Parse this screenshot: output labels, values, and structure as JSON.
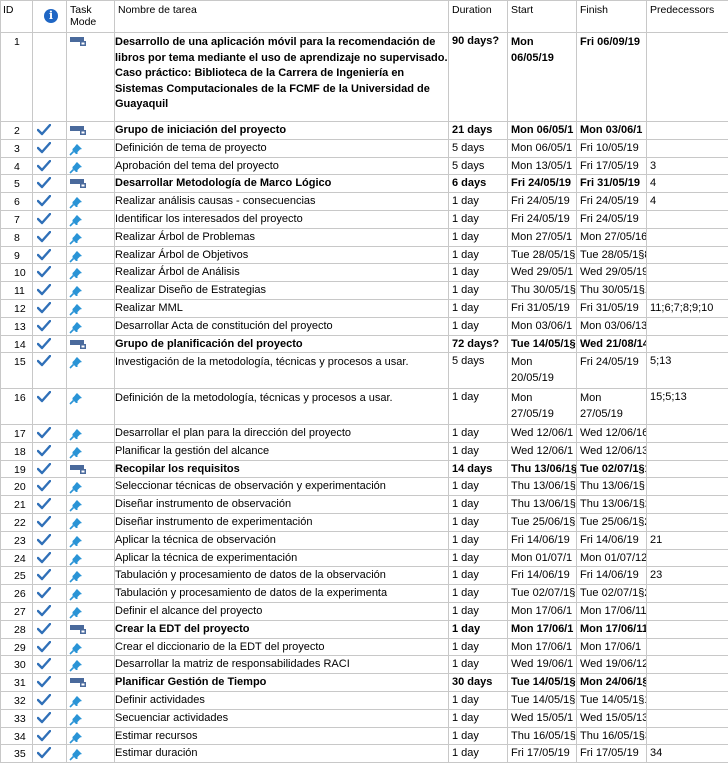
{
  "columns": {
    "id": "ID",
    "info_icon": "info-icon",
    "task_mode": "Task Mode",
    "name": "Nombre de tarea",
    "duration": "Duration",
    "start": "Start",
    "finish": "Finish",
    "predecessors": "Predecessors"
  },
  "colors": {
    "check": "#3070b8",
    "pin": "#2a94d6",
    "summary_bar": "#4a6a9c",
    "grid": "#c8c8c8"
  },
  "rows": [
    {
      "id": "1",
      "done": false,
      "mode": "summary",
      "level": 0,
      "bold": true,
      "lines": 6,
      "name": "Desarrollo de una aplicación móvil para la recomendación de libros por tema mediante el uso de aprendizaje no supervisado. Caso práctico: Biblioteca de la Carrera de Ingeniería en Sistemas Computacionales de la FCMF de la Universidad de Guayaquil",
      "duration": "90 days?",
      "start": "Mon 06/05/19",
      "finish": "Fri 06/09/19",
      "predecessors": ""
    },
    {
      "id": "2",
      "done": true,
      "mode": "summary",
      "level": 1,
      "bold": true,
      "name": "Grupo de iniciación del proyecto",
      "duration": "21 days",
      "start": "Mon 06/05/1",
      "finish": "Mon 03/06/1",
      "predecessors": ""
    },
    {
      "id": "3",
      "done": true,
      "mode": "manual",
      "level": 2,
      "bold": false,
      "name": "Definición de tema de proyecto",
      "duration": "5 days",
      "start": "Mon 06/05/1",
      "finish": "Fri 10/05/19",
      "predecessors": ""
    },
    {
      "id": "4",
      "done": true,
      "mode": "manual",
      "level": 2,
      "bold": false,
      "name": "Aprobación del tema del proyecto",
      "duration": "5 days",
      "start": "Mon 13/05/1",
      "finish": "Fri 17/05/19",
      "predecessors": "3"
    },
    {
      "id": "5",
      "done": true,
      "mode": "summary",
      "level": 2,
      "bold": true,
      "name": "Desarrollar Metodología de Marco Lógico",
      "duration": "6 days",
      "start": "Fri 24/05/19",
      "finish": "Fri 31/05/19",
      "predecessors": "4"
    },
    {
      "id": "6",
      "done": true,
      "mode": "manual",
      "level": 3,
      "bold": false,
      "name": "Realizar análisis causas - consecuencias",
      "duration": "1 day",
      "start": "Fri 24/05/19",
      "finish": "Fri 24/05/19",
      "predecessors": "4"
    },
    {
      "id": "7",
      "done": true,
      "mode": "manual",
      "level": 3,
      "bold": false,
      "name": "Identificar los interesados del proyecto",
      "duration": "1 day",
      "start": "Fri 24/05/19",
      "finish": "Fri 24/05/19",
      "predecessors": ""
    },
    {
      "id": "8",
      "done": true,
      "mode": "manual",
      "level": 3,
      "bold": false,
      "name": "Realizar Árbol de Problemas",
      "duration": "1 day",
      "start": "Mon 27/05/1",
      "finish": "Mon 27/05/16;7",
      "predecessors": ""
    },
    {
      "id": "9",
      "done": true,
      "mode": "manual",
      "level": 3,
      "bold": false,
      "name": "Realizar Árbol de Objetivos",
      "duration": "1 day",
      "start": "Tue 28/05/1§",
      "finish": "Tue 28/05/1§8",
      "predecessors": ""
    },
    {
      "id": "10",
      "done": true,
      "mode": "manual",
      "level": 3,
      "bold": false,
      "name": "Realizar Árbol de Análisis",
      "duration": "1 day",
      "start": "Wed 29/05/1",
      "finish": "Wed 29/05/19",
      "predecessors": ""
    },
    {
      "id": "11",
      "done": true,
      "mode": "manual",
      "level": 3,
      "bold": false,
      "name": "Realizar Diseño de Estrategias",
      "duration": "1 day",
      "start": "Thu 30/05/1§",
      "finish": "Thu 30/05/1§10",
      "predecessors": ""
    },
    {
      "id": "12",
      "done": true,
      "mode": "manual",
      "level": 3,
      "bold": false,
      "name": "Realizar MML",
      "duration": "1 day",
      "start": "Fri 31/05/19",
      "finish": "Fri 31/05/19",
      "predecessors": "11;6;7;8;9;10"
    },
    {
      "id": "13",
      "done": true,
      "mode": "manual",
      "level": 2,
      "bold": false,
      "name": "Desarrollar Acta de constitución del proyecto",
      "duration": "1 day",
      "start": "Mon 03/06/1",
      "finish": "Mon 03/06/13;4;5;7",
      "predecessors": ""
    },
    {
      "id": "14",
      "done": true,
      "mode": "summary",
      "level": 1,
      "bold": true,
      "name": "Grupo de planificación del proyecto",
      "duration": "72 days?",
      "start": "Tue 14/05/1§",
      "finish": "Wed 21/08/14",
      "predecessors": ""
    },
    {
      "id": "15",
      "done": true,
      "mode": "manual",
      "level": 2,
      "bold": false,
      "lines": 2,
      "name": "Investigación de la metodología, técnicas y procesos a usar.",
      "duration": "5 days",
      "start": "Mon 20/05/19",
      "finish": "Fri 24/05/19",
      "predecessors": "5;13"
    },
    {
      "id": "16",
      "done": true,
      "mode": "manual",
      "level": 2,
      "bold": false,
      "lines": 2,
      "name": "Definición de la metodología, técnicas y procesos a usar.",
      "duration": "1 day",
      "start": "Mon 27/05/19",
      "finish": "Mon 27/05/19",
      "predecessors": "15;5;13"
    },
    {
      "id": "17",
      "done": true,
      "mode": "manual",
      "level": 2,
      "bold": false,
      "name": "Desarrollar el plan para la dirección del proyecto",
      "duration": "1 day",
      "start": "Wed 12/06/1",
      "finish": "Wed 12/06/16;5;13;15",
      "predecessors": ""
    },
    {
      "id": "18",
      "done": true,
      "mode": "manual",
      "level": 2,
      "bold": false,
      "name": "Planificar la gestión del alcance",
      "duration": "1 day",
      "start": "Wed 12/06/1",
      "finish": "Wed 12/06/13;5;15;16;17",
      "predecessors": ""
    },
    {
      "id": "19",
      "done": true,
      "mode": "summary",
      "level": 2,
      "bold": true,
      "name": "Recopilar los requisitos",
      "duration": "14 days",
      "start": "Thu 13/06/1§",
      "finish": "Tue 02/07/1§18;5;13;15;16",
      "predecessors": ""
    },
    {
      "id": "20",
      "done": true,
      "mode": "manual",
      "level": 3,
      "bold": false,
      "name": "Seleccionar técnicas de observación y experimentación",
      "duration": "1 day",
      "start": "Thu 13/06/1§",
      "finish": "Thu 13/06/1§",
      "predecessors": ""
    },
    {
      "id": "21",
      "done": true,
      "mode": "manual",
      "level": 3,
      "bold": false,
      "name": "Diseñar instrumento de observación",
      "duration": "1 day",
      "start": "Thu 13/06/1§",
      "finish": "Thu 13/06/1§20",
      "predecessors": ""
    },
    {
      "id": "22",
      "done": true,
      "mode": "manual",
      "level": 3,
      "bold": false,
      "name": "Diseñar instrumento de experimentación",
      "duration": "1 day",
      "start": "Tue 25/06/1§",
      "finish": "Tue 25/06/1§20",
      "predecessors": ""
    },
    {
      "id": "23",
      "done": true,
      "mode": "manual",
      "level": 3,
      "bold": false,
      "name": "Aplicar la técnica de observación",
      "duration": "1 day",
      "start": "Fri 14/06/19",
      "finish": "Fri 14/06/19",
      "predecessors": "21"
    },
    {
      "id": "24",
      "done": true,
      "mode": "manual",
      "level": 3,
      "bold": false,
      "name": "Aplicar la técnica de experimentación",
      "duration": "1 day",
      "start": "Mon 01/07/1",
      "finish": "Mon 01/07/122",
      "predecessors": ""
    },
    {
      "id": "25",
      "done": true,
      "mode": "manual",
      "level": 3,
      "bold": false,
      "name": "Tabulación y procesamiento de datos de la observación",
      "duration": "1 day",
      "start": "Fri 14/06/19",
      "finish": "Fri 14/06/19",
      "predecessors": "23"
    },
    {
      "id": "26",
      "done": true,
      "mode": "manual",
      "level": 3,
      "bold": false,
      "name": "Tabulación y procesamiento de datos de la experimenta",
      "duration": "1 day",
      "start": "Tue 02/07/1§",
      "finish": "Tue 02/07/1§24",
      "predecessors": ""
    },
    {
      "id": "27",
      "done": true,
      "mode": "manual",
      "level": 2,
      "bold": false,
      "name": "Definir el alcance del proyecto",
      "duration": "1 day",
      "start": "Mon 17/06/1",
      "finish": "Mon 17/06/118;13;5;15;16",
      "predecessors": ""
    },
    {
      "id": "28",
      "done": true,
      "mode": "summary",
      "level": 2,
      "bold": true,
      "name": "Crear la EDT del proyecto",
      "duration": "1 day",
      "start": "Mon 17/06/1",
      "finish": "Mon 17/06/113;5;15;16;17",
      "predecessors": ""
    },
    {
      "id": "29",
      "done": true,
      "mode": "manual",
      "level": 3,
      "bold": false,
      "name": "Crear el diccionario de la EDT del proyecto",
      "duration": "1 day",
      "start": "Mon 17/06/1",
      "finish": "Mon 17/06/1",
      "predecessors": ""
    },
    {
      "id": "30",
      "done": true,
      "mode": "manual",
      "level": 2,
      "bold": false,
      "name": "Desarrollar la matriz de responsabilidades RACI",
      "duration": "1 day",
      "start": "Wed 19/06/1",
      "finish": "Wed 19/06/128",
      "predecessors": ""
    },
    {
      "id": "31",
      "done": true,
      "mode": "summary",
      "level": 2,
      "bold": true,
      "name": "Planificar Gestión de Tiempo",
      "duration": "30 days",
      "start": "Tue 14/05/1§",
      "finish": "Mon 24/06/1§15;16;17;18",
      "predecessors": ""
    },
    {
      "id": "32",
      "done": true,
      "mode": "manual",
      "level": 3,
      "bold": false,
      "name": "Definir actividades",
      "duration": "1 day",
      "start": "Tue 14/05/1§",
      "finish": "Tue 14/05/1§13",
      "predecessors": ""
    },
    {
      "id": "33",
      "done": true,
      "mode": "manual",
      "level": 3,
      "bold": false,
      "name": "Secuenciar actividades",
      "duration": "1 day",
      "start": "Wed 15/05/1",
      "finish": "Wed 15/05/132",
      "predecessors": ""
    },
    {
      "id": "34",
      "done": true,
      "mode": "manual",
      "level": 3,
      "bold": false,
      "name": "Estimar recursos",
      "duration": "1 day",
      "start": "Thu 16/05/1§",
      "finish": "Thu 16/05/1§33",
      "predecessors": ""
    },
    {
      "id": "35",
      "done": true,
      "mode": "manual",
      "level": 3,
      "bold": false,
      "name": "Estimar duración",
      "duration": "1 day",
      "start": "Fri 17/05/19",
      "finish": "Fri 17/05/19",
      "predecessors": "34"
    }
  ]
}
